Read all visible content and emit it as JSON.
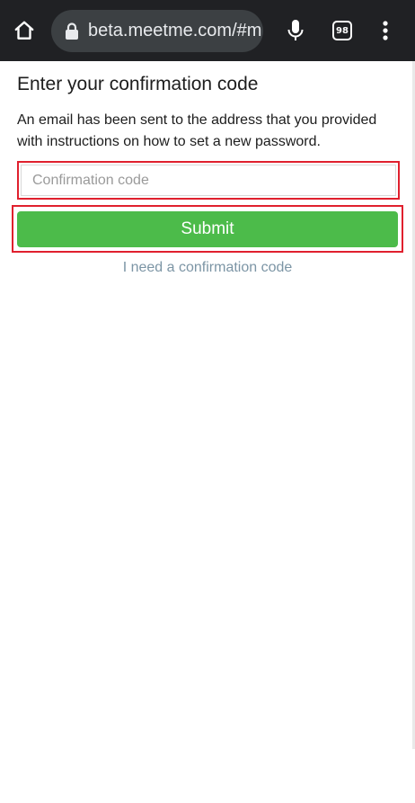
{
  "browser": {
    "url": "beta.meetme.com/#m",
    "tab_count": "98",
    "home_icon": "home-icon",
    "lock_icon": "lock-icon",
    "mic_icon": "mic-icon",
    "menu_icon": "more-vert-icon"
  },
  "form": {
    "title": "Enter your confirmation code",
    "description": "An email has been sent to the address that you provided with instructions on how to set a new password.",
    "code_placeholder": "Confirmation code",
    "code_value": "",
    "submit_label": "Submit",
    "link_text": "I need a confirmation code"
  },
  "colors": {
    "submit_bg": "#4cbb4a",
    "highlight": "#e0202e",
    "link": "#7c95a5",
    "browser_bar": "#202124"
  }
}
